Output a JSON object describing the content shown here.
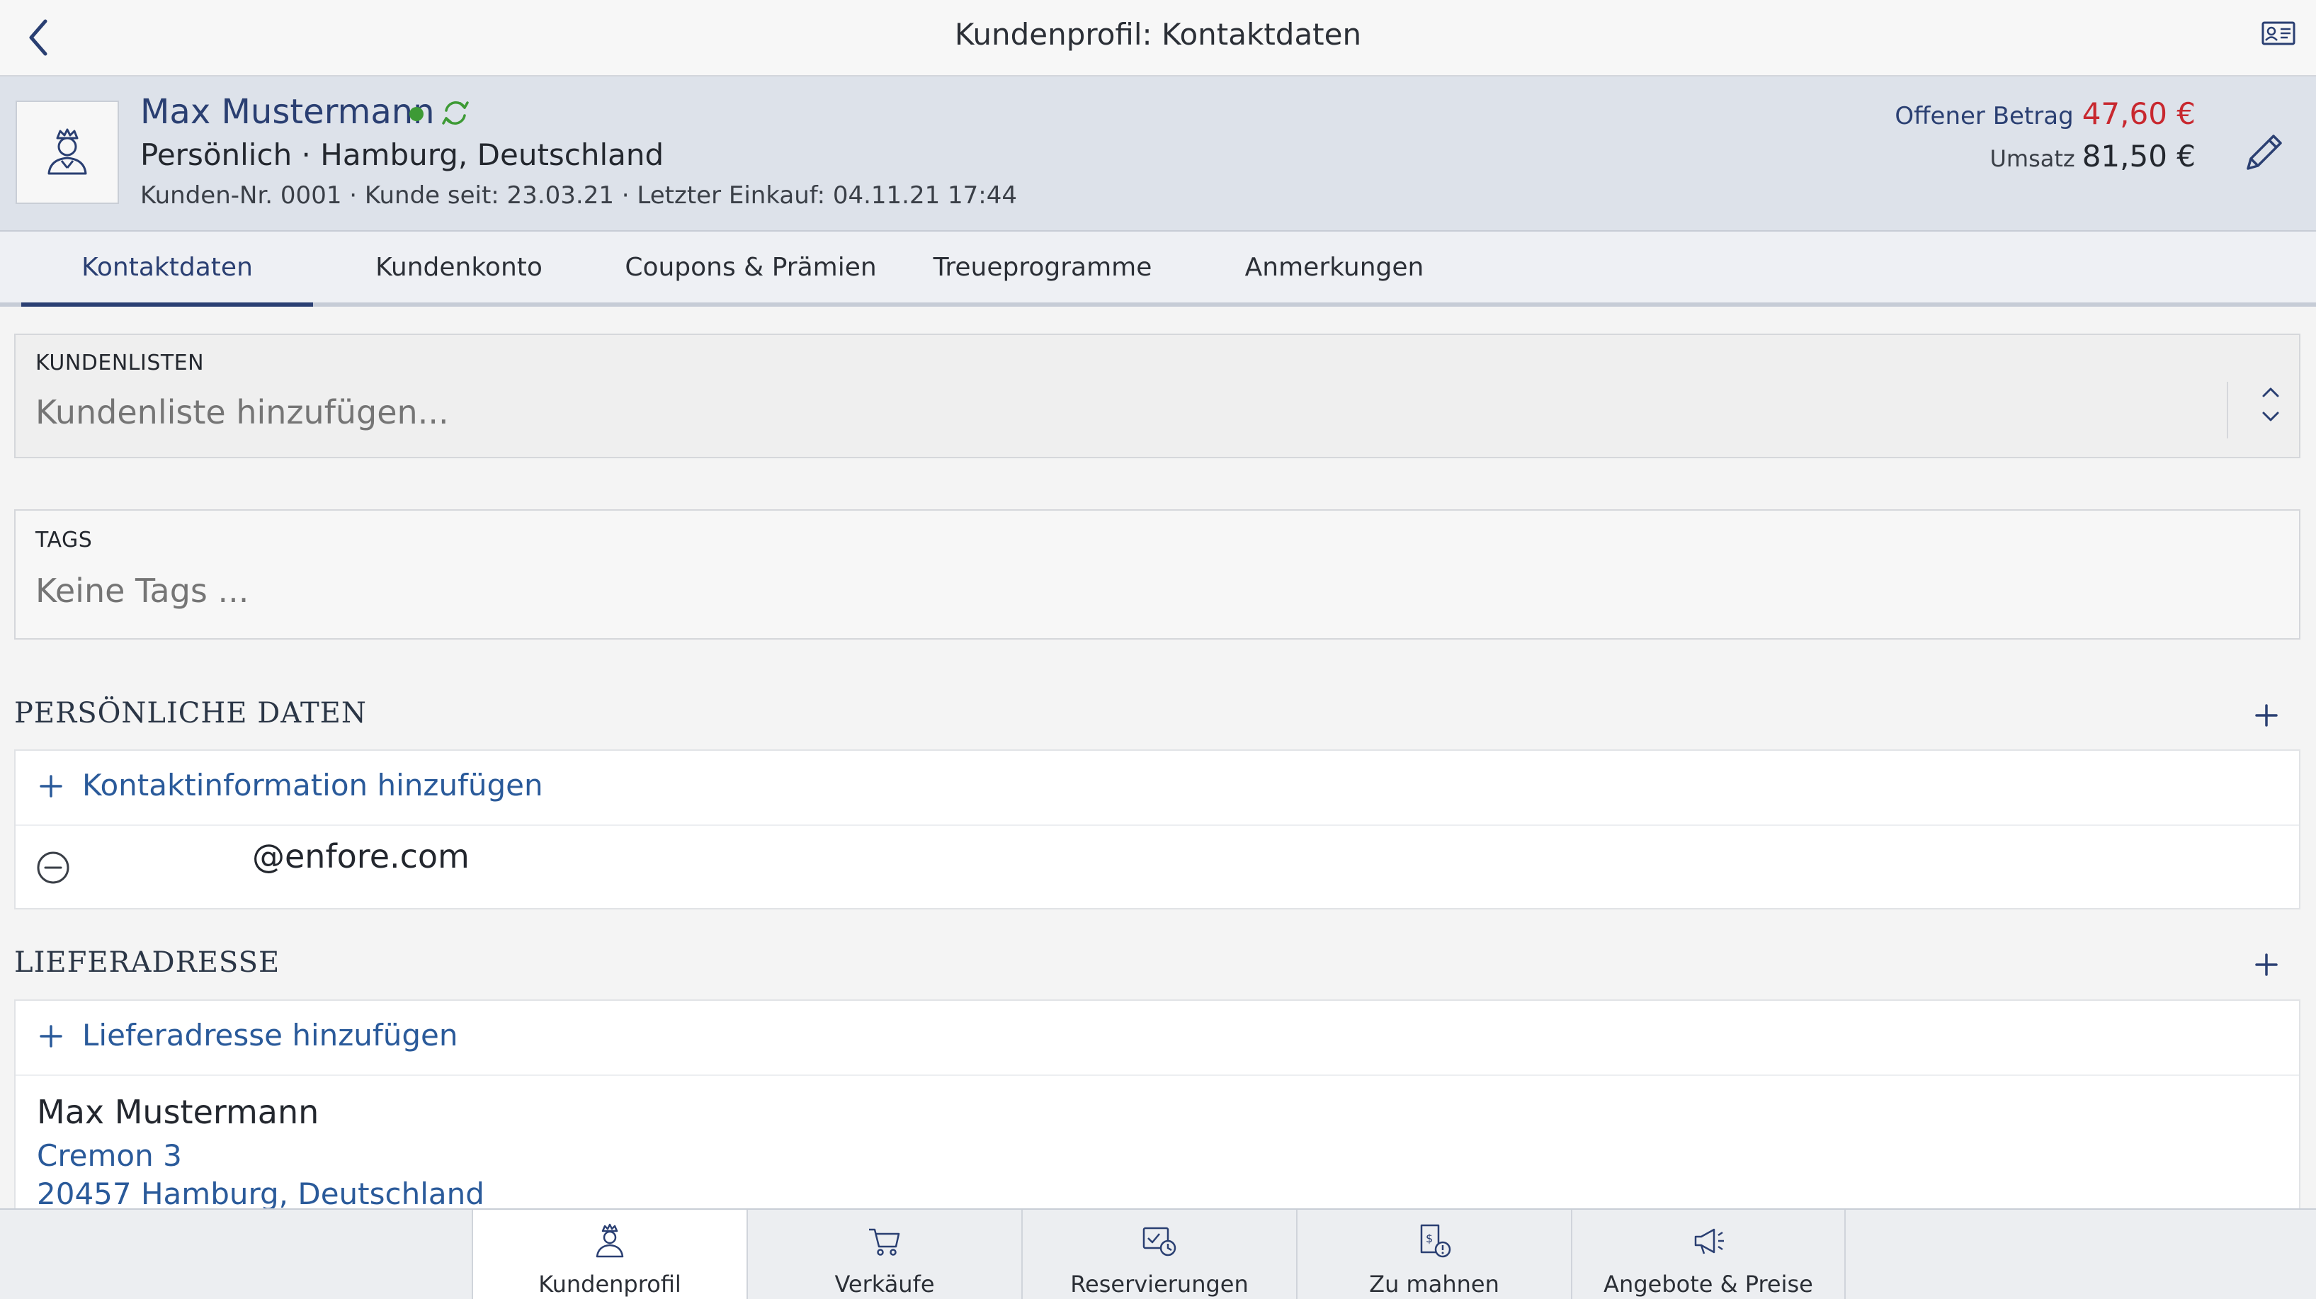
{
  "header": {
    "title": "Kundenprofil: Kontaktdaten"
  },
  "customer": {
    "name": "Max Mustermann",
    "subtitle": "Persönlich · Hamburg, Deutschland",
    "meta": "Kunden-Nr. 0001 · Kunde seit: 23.03.21 · Letzter Einkauf: 04.11.21 17:44",
    "open_amount_label": "Offener Betrag",
    "open_amount_value": "47,60 €",
    "turnover_label": "Umsatz",
    "turnover_value": "81,50 €"
  },
  "tabs": [
    {
      "label": "Kontaktdaten",
      "active": true
    },
    {
      "label": "Kundenkonto"
    },
    {
      "label": "Coupons & Prämien"
    },
    {
      "label": "Treueprogramme"
    },
    {
      "label": "Anmerkungen"
    }
  ],
  "customer_lists": {
    "label": "KUNDENLISTEN",
    "placeholder": "Kundenliste hinzufügen..."
  },
  "tags": {
    "label": "TAGS",
    "placeholder": "Keine Tags ..."
  },
  "personal": {
    "title": "PERSÖNLICHE DATEN",
    "add_label": "Kontaktinformation hinzufügen",
    "email": "@enfore.com"
  },
  "delivery": {
    "title": "LIEFERADRESSE",
    "add_label": "Lieferadresse hinzufügen",
    "name": "Max Mustermann",
    "street": "Cremon 3",
    "city": "20457 Hamburg, Deutschland"
  },
  "bottom_nav": [
    {
      "label": "Kundenprofil",
      "icon": "customer-icon",
      "active": true
    },
    {
      "label": "Verkäufe",
      "icon": "cart-icon"
    },
    {
      "label": "Reservierungen",
      "icon": "reservation-icon"
    },
    {
      "label": "Zu mahnen",
      "icon": "dunning-icon"
    },
    {
      "label": "Angebote & Preise",
      "icon": "megaphone-icon"
    }
  ],
  "colors": {
    "accent": "#2a3f72",
    "link": "#2a5a9a",
    "danger": "#c8282f",
    "online": "#3d9a35"
  }
}
